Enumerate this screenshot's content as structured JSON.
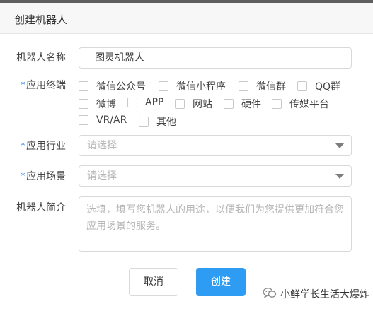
{
  "dialog": {
    "title": "创建机器人"
  },
  "form": {
    "name": {
      "label": "机器人名称",
      "value": "图灵机器人"
    },
    "terminal": {
      "required": "*",
      "label": "应用终端",
      "options": [
        "微信公众号",
        "微信小程序",
        "微信群",
        "QQ群",
        "微博",
        "APP",
        "网站",
        "硬件",
        "传媒平台",
        "VR/AR",
        "其他"
      ]
    },
    "industry": {
      "required": "*",
      "label": "应用行业",
      "placeholder": "请选择"
    },
    "scene": {
      "required": "*",
      "label": "应用场景",
      "placeholder": "请选择"
    },
    "intro": {
      "label": "机器人简介",
      "placeholder": "选填，填写您机器人的用途，以便我们为您提供更加符合您应用场景的服务。"
    }
  },
  "buttons": {
    "cancel": "取消",
    "create": "创建"
  },
  "watermark": {
    "text": "小鲜学长生活大爆炸",
    "icon": "wechat-icon"
  },
  "colors": {
    "accent": "#2f9cf4",
    "required": "#3d8bf0",
    "header_bg": "#f7f7f7"
  }
}
